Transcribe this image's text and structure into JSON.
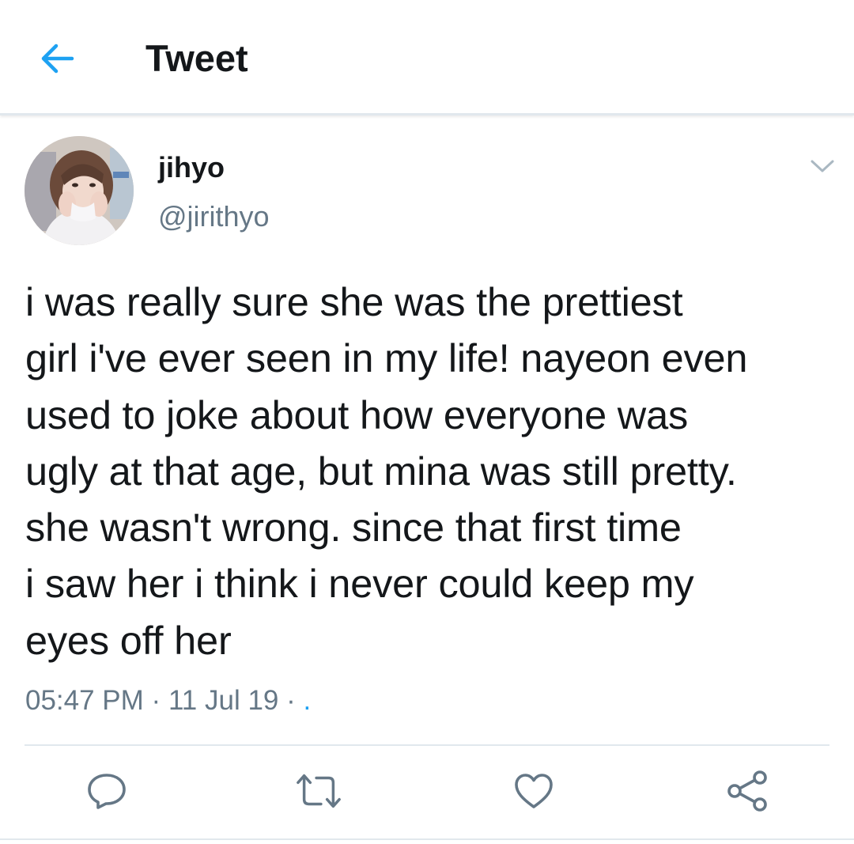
{
  "header": {
    "title": "Tweet",
    "back_icon": "arrow-left-icon",
    "accent": "#1da1f2"
  },
  "author": {
    "name": "jihyo",
    "handle": "@jirithyo",
    "avatar_icon": "profile-photo"
  },
  "tweet": {
    "text": "i was really sure she was the prettiest\ngirl i've ever seen in my life! nayeon even\nused to joke about how everyone was\nugly at that age, but mina was still pretty.\nshe wasn't wrong. since that first time\ni saw her i think i never could keep my\neyes off her",
    "time": "05:47 PM",
    "date": "11 Jul 19",
    "separator": "·",
    "source": "."
  },
  "actions": {
    "reply_icon": "reply-icon",
    "retweet_icon": "retweet-icon",
    "like_icon": "heart-icon",
    "share_icon": "share-icon",
    "icon_color": "#657786"
  }
}
